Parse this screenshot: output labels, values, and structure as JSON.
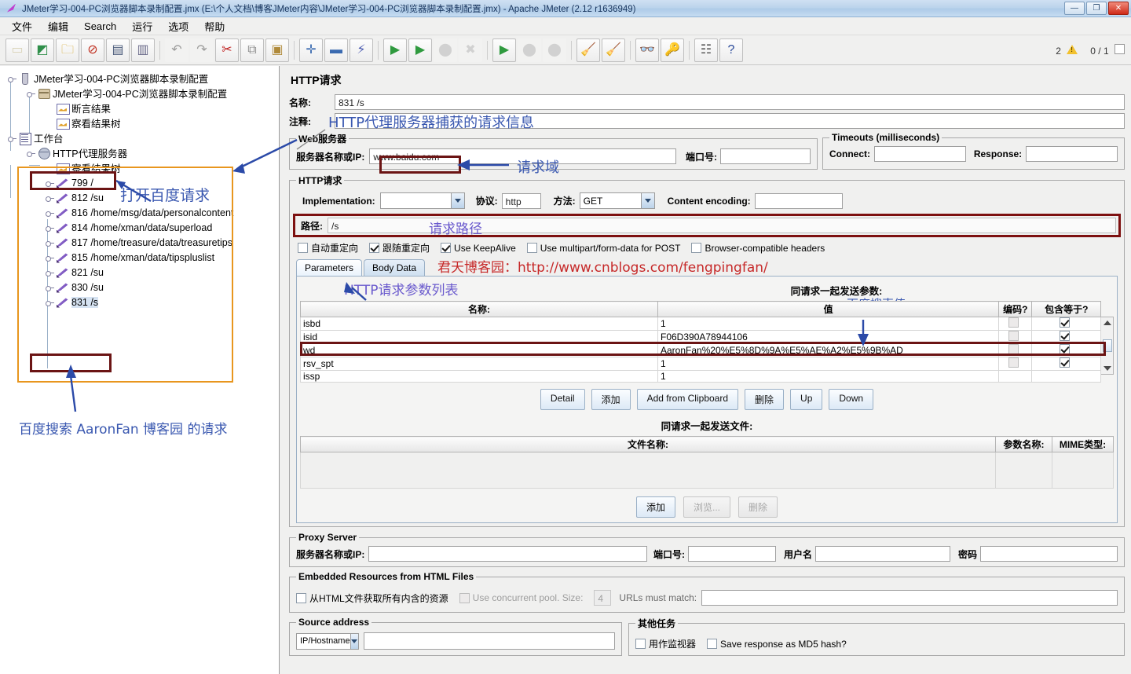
{
  "window": {
    "title": "JMeter学习-004-PC浏览器脚本录制配置.jmx (E:\\个人文档\\博客JMeter内容\\JMeter学习-004-PC浏览器脚本录制配置.jmx) - Apache JMeter (2.12 r1636949)",
    "minimize": "—",
    "maximize": "❐",
    "close": "✕"
  },
  "menubar": {
    "items": [
      {
        "label": "文件"
      },
      {
        "label": "编辑"
      },
      {
        "label": "Search"
      },
      {
        "label": "运行"
      },
      {
        "label": "选项"
      },
      {
        "label": "帮助"
      }
    ]
  },
  "toolbar": {
    "buttons": [
      {
        "name": "new",
        "glyph": "📄"
      },
      {
        "name": "templates",
        "glyph": "🗂"
      },
      {
        "name": "open",
        "glyph": "📂"
      },
      {
        "name": "close",
        "glyph": "📕"
      },
      {
        "name": "save",
        "glyph": "💾"
      },
      {
        "name": "save-as",
        "glyph": "📝"
      },
      {
        "name": "undo",
        "glyph": "↶"
      },
      {
        "name": "redo",
        "glyph": "↷"
      },
      {
        "name": "cut",
        "glyph": "✂"
      },
      {
        "name": "copy",
        "glyph": "⧉"
      },
      {
        "name": "paste",
        "glyph": "📋"
      },
      {
        "name": "expand-all",
        "glyph": "✛"
      },
      {
        "name": "collapse-all",
        "glyph": "—"
      },
      {
        "name": "toggle",
        "glyph": "⚡"
      },
      {
        "name": "start",
        "glyph": "▶"
      },
      {
        "name": "start-no-pauses",
        "glyph": "▶"
      },
      {
        "name": "stop",
        "glyph": "●"
      },
      {
        "name": "shutdown",
        "glyph": "✖"
      },
      {
        "name": "remote-start-all",
        "glyph": "▶"
      },
      {
        "name": "remote-stop-all",
        "glyph": "●"
      },
      {
        "name": "remote-shutdown-all",
        "glyph": "●"
      },
      {
        "name": "clear",
        "glyph": "🧹"
      },
      {
        "name": "clear-all",
        "glyph": "🧹"
      },
      {
        "name": "search",
        "glyph": "🔭"
      },
      {
        "name": "search-reset",
        "glyph": "🔑"
      },
      {
        "name": "function-helper",
        "glyph": "☰"
      },
      {
        "name": "help",
        "glyph": "?"
      }
    ],
    "warning_count": "2",
    "thread_count": "0 / 1"
  },
  "tree": {
    "nodes": [
      {
        "label": "JMeter学习-004-PC浏览器脚本录制配置",
        "icon": "test-plan-icon",
        "indent": 0,
        "handle": true
      },
      {
        "label": "JMeter学习-004-PC浏览器脚本录制配置",
        "icon": "thread-group-icon",
        "indent": 1,
        "handle": true
      },
      {
        "label": "断言结果",
        "icon": "listener-icon",
        "indent": 2,
        "handle": false
      },
      {
        "label": "察看结果树",
        "icon": "listener-icon",
        "indent": 2,
        "handle": false
      },
      {
        "label": "工作台",
        "icon": "workbench-icon",
        "indent": 0,
        "handle": true
      },
      {
        "label": "HTTP代理服务器",
        "icon": "proxy-icon",
        "indent": 1,
        "handle": true
      },
      {
        "label": "察看结果树",
        "icon": "listener-icon",
        "indent": 2,
        "handle": false
      },
      {
        "label": "799 /",
        "icon": "http-sampler-icon",
        "indent": 2,
        "handle": true
      },
      {
        "label": "812 /su",
        "icon": "http-sampler-icon",
        "indent": 2,
        "handle": true
      },
      {
        "label": "816 /home/msg/data/personalcontent",
        "icon": "http-sampler-icon",
        "indent": 2,
        "handle": true
      },
      {
        "label": "814 /home/xman/data/superload",
        "icon": "http-sampler-icon",
        "indent": 2,
        "handle": true
      },
      {
        "label": "817 /home/treasure/data/treasuretips",
        "icon": "http-sampler-icon",
        "indent": 2,
        "handle": true
      },
      {
        "label": "815 /home/xman/data/tipspluslist",
        "icon": "http-sampler-icon",
        "indent": 2,
        "handle": true
      },
      {
        "label": "821 /su",
        "icon": "http-sampler-icon",
        "indent": 2,
        "handle": true
      },
      {
        "label": "830 /su",
        "icon": "http-sampler-icon",
        "indent": 2,
        "handle": true
      },
      {
        "label": "831 /s",
        "icon": "http-sampler-icon",
        "indent": 2,
        "handle": true,
        "selected": true
      }
    ]
  },
  "annotations": {
    "open_baidu_request": "打开百度请求",
    "baidu_search_request": "百度搜索 AaronFan 博客园 的请求",
    "proxy_captured_info": "HTTP代理服务器捕获的请求信息",
    "request_domain": "请求域",
    "request_path": "请求路径",
    "param_list": "HTTP请求参数列表",
    "blog_link": "君天博客园：http://www.cnblogs.com/fengpingfan/",
    "baidu_search_value": "百度搜索值",
    "colors": {
      "orange_box": "#e8961e",
      "dark_red_box": "#6b1414",
      "blue_text": "#3a58b0",
      "purple_text": "#6a5acd",
      "red_link": "#c62828"
    }
  },
  "request_panel": {
    "title": "HTTP请求",
    "name_label": "名称:",
    "name_value": "831 /s",
    "comment_label": "注释:",
    "comment_value": "",
    "web_server": {
      "legend": "Web服务器",
      "server_label": "服务器名称或IP:",
      "server_value": "www.baidu.com",
      "port_label": "端口号:",
      "port_value": ""
    },
    "timeouts": {
      "legend": "Timeouts (milliseconds)",
      "connect_label": "Connect:",
      "connect_value": "",
      "response_label": "Response:",
      "response_value": ""
    },
    "http_request": {
      "legend": "HTTP请求",
      "implementation_label": "Implementation:",
      "implementation_value": "",
      "protocol_label": "协议:",
      "protocol_value": "http",
      "method_label": "方法:",
      "method_value": "GET",
      "content_encoding_label": "Content encoding:",
      "content_encoding_value": "",
      "path_label": "路径:",
      "path_value": "/s",
      "checkboxes": [
        {
          "label": "自动重定向",
          "checked": false
        },
        {
          "label": "跟随重定向",
          "checked": true
        },
        {
          "label": "Use KeepAlive",
          "checked": true
        },
        {
          "label": "Use multipart/form-data for POST",
          "checked": false
        },
        {
          "label": "Browser-compatible headers",
          "checked": false
        }
      ]
    },
    "tabs": [
      {
        "label": "Parameters",
        "active": true
      },
      {
        "label": "Body Data",
        "active": false
      }
    ],
    "params_caption": "同请求一起发送参数:",
    "params_table": {
      "headers": [
        "名称:",
        "值",
        "编码?",
        "包含等于?"
      ],
      "rows": [
        {
          "name": "isbd",
          "value": "1",
          "encode": false,
          "include_equals": true
        },
        {
          "name": "isid",
          "value": "F06D390A78944106",
          "encode": false,
          "include_equals": true
        },
        {
          "name": "wd",
          "value": "AaronFan%20%E5%8D%9A%E5%AE%A2%E5%9B%AD",
          "encode": false,
          "include_equals": true,
          "highlight": true
        },
        {
          "name": "rsv_spt",
          "value": "1",
          "encode": false,
          "include_equals": true
        },
        {
          "name": "issp",
          "value": "1",
          "encode": false,
          "include_equals": true
        }
      ]
    },
    "params_buttons": [
      {
        "label": "Detail",
        "disabled": false
      },
      {
        "label": "添加",
        "disabled": false
      },
      {
        "label": "Add from Clipboard",
        "disabled": false
      },
      {
        "label": "删除",
        "disabled": false
      },
      {
        "label": "Up",
        "disabled": false
      },
      {
        "label": "Down",
        "disabled": false
      }
    ],
    "files_caption": "同请求一起发送文件:",
    "files_table": {
      "headers": [
        "文件名称:",
        "参数名称:",
        "MIME类型:"
      ],
      "rows": []
    },
    "files_buttons": [
      {
        "label": "添加",
        "disabled": false
      },
      {
        "label": "浏览...",
        "disabled": true
      },
      {
        "label": "删除",
        "disabled": true
      }
    ],
    "proxy_server": {
      "legend": "Proxy Server",
      "server_label": "服务器名称或IP:",
      "server_value": "",
      "port_label": "端口号:",
      "port_value": "",
      "username_label": "用户名",
      "username_value": "",
      "password_label": "密码",
      "password_value": ""
    },
    "embedded": {
      "legend": "Embedded Resources from HTML Files",
      "retrieve_label": "从HTML文件获取所有内含的资源",
      "retrieve_checked": false,
      "pool_label": "Use concurrent pool. Size:",
      "pool_checked": false,
      "pool_size": "4",
      "urls_label": "URLs must match:",
      "urls_value": ""
    },
    "source_address": {
      "legend": "Source address",
      "type_value": "IP/Hostname",
      "value": ""
    },
    "other_tasks": {
      "legend": "其他任务",
      "checkboxes": [
        {
          "label": "用作监视器",
          "checked": false
        },
        {
          "label": "Save response as MD5 hash?",
          "checked": false
        }
      ]
    }
  }
}
